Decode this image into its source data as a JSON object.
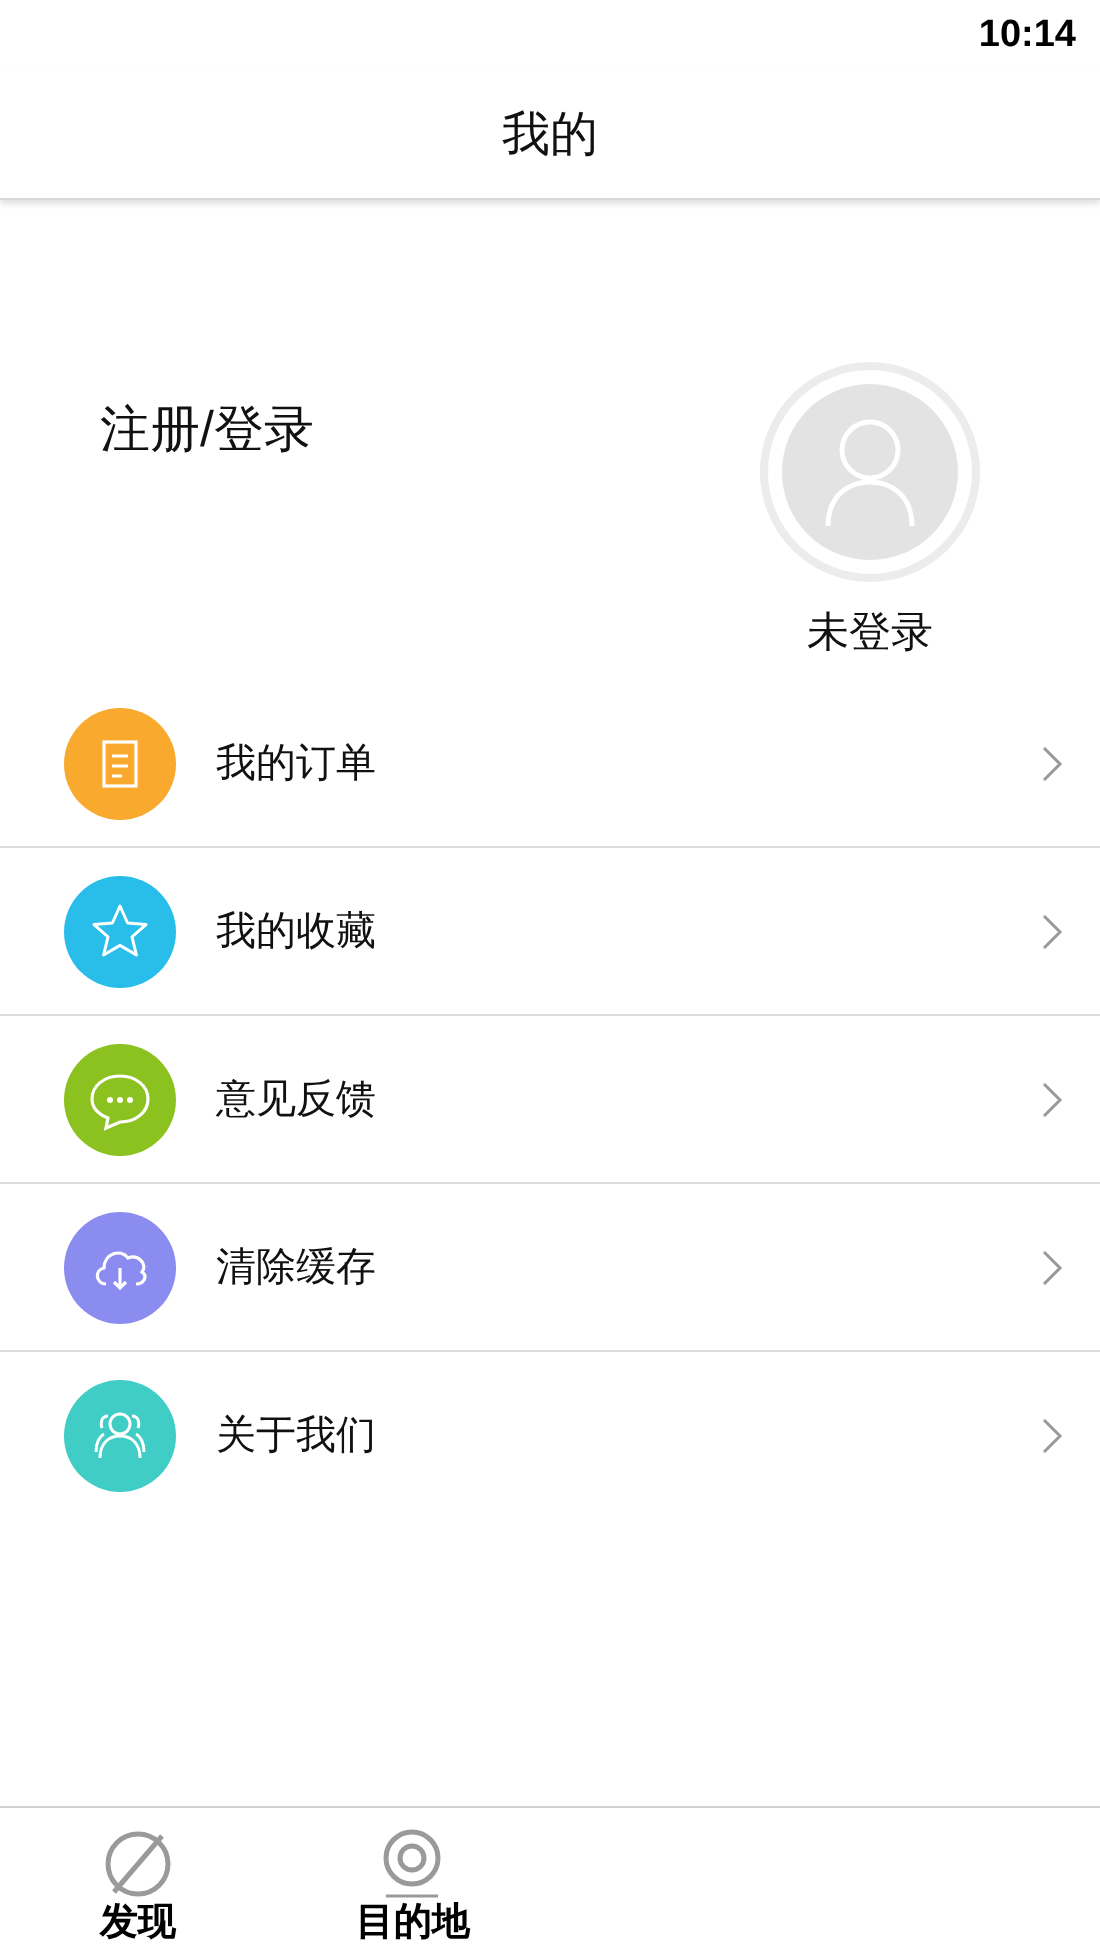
{
  "status_bar": {
    "time": "10:14"
  },
  "header": {
    "title": "我的"
  },
  "profile": {
    "login_link": "注册/登录",
    "status": "未登录"
  },
  "menu": [
    {
      "label": "我的订单",
      "color": "#f8a92e"
    },
    {
      "label": "我的收藏",
      "color": "#29bde9"
    },
    {
      "label": "意见反馈",
      "color": "#8cc21f"
    },
    {
      "label": "清除缓存",
      "color": "#8b8cf0"
    },
    {
      "label": "关于我们",
      "color": "#3fcdc6"
    }
  ],
  "tab_bar": [
    {
      "label": "发现"
    },
    {
      "label": "目的地"
    }
  ]
}
